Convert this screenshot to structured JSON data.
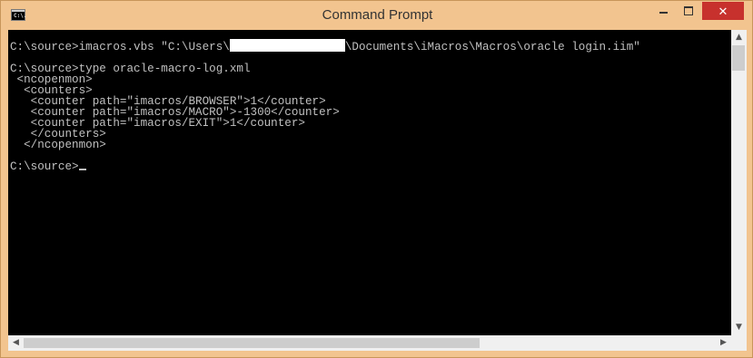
{
  "window": {
    "title": "Command Prompt",
    "icon_text": "C:\\.",
    "controls": {
      "minimize": "",
      "maximize": "",
      "close": "✕"
    }
  },
  "console": {
    "line1_pre": "C:\\source>imacros.vbs \"C:\\Users\\",
    "line1_post": "\\Documents\\iMacros\\Macros\\oracle login.iim\"",
    "line2": "",
    "line3": "C:\\source>type oracle-macro-log.xml",
    "line4": " <ncopenmon>",
    "line5": "  <counters>",
    "line6": "   <counter path=\"imacros/BROWSER\">1</counter>",
    "line7": "   <counter path=\"imacros/MACRO\">-1300</counter>",
    "line8": "   <counter path=\"imacros/EXIT\">1</counter>",
    "line9": "   </counters>",
    "line10": "  </ncopenmon>",
    "line11": "",
    "prompt": "C:\\source>"
  },
  "scrollbars": {
    "up_arrow": "▲",
    "down_arrow": "▼",
    "left_arrow": "◀",
    "right_arrow": "▶"
  },
  "colors": {
    "frame": "#f2c48f",
    "console_bg": "#000000",
    "console_fg": "#c0c0c0",
    "close_btn": "#c7312d"
  }
}
